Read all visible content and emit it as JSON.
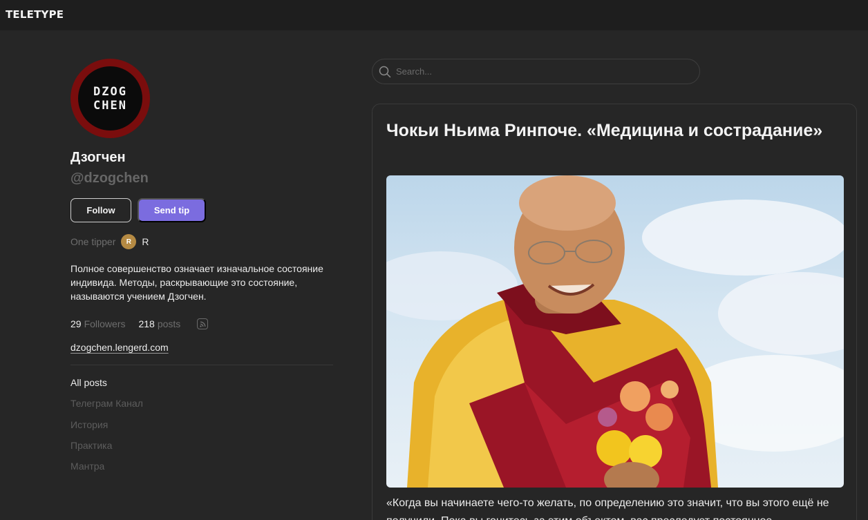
{
  "header": {
    "logo": "TELETYPE"
  },
  "profile": {
    "avatar_lines": [
      "DZOG",
      "CHEN"
    ],
    "name": "Дзогчен",
    "handle": "@dzogchen",
    "follow_label": "Follow",
    "tip_label": "Send tip",
    "tipper_label": "One tipper",
    "tipper_initial": "R",
    "tipper_name": "R",
    "bio": "Полное совершенство означает изначальное состояние индивида. Методы, раскрывающие это состояние, называются учением Дзогчен.",
    "followers_count": "29",
    "followers_label": "Followers",
    "posts_count": "218",
    "posts_label": "posts",
    "site": "dzogchen.lengerd.com"
  },
  "nav": {
    "items": [
      {
        "label": "All posts",
        "active": true
      },
      {
        "label": "Телеграм Канал",
        "active": false
      },
      {
        "label": "История",
        "active": false
      },
      {
        "label": "Практика",
        "active": false
      },
      {
        "label": "Мантра",
        "active": false
      }
    ]
  },
  "search": {
    "placeholder": "Search..."
  },
  "post": {
    "title": "Чокьи Ньима Ринпоче. «Медицина и сострадание»",
    "excerpt": "«Когда вы начинаете чего-то желать, по определению это значит, что вы этого ещё не получили. Пока вы гонитесь за этим объектом, вас преследует постоянное"
  },
  "colors": {
    "accent": "#7b6cdf",
    "avatar_ring": "#7a0d0d",
    "tipper_badge": "#b58a43"
  }
}
